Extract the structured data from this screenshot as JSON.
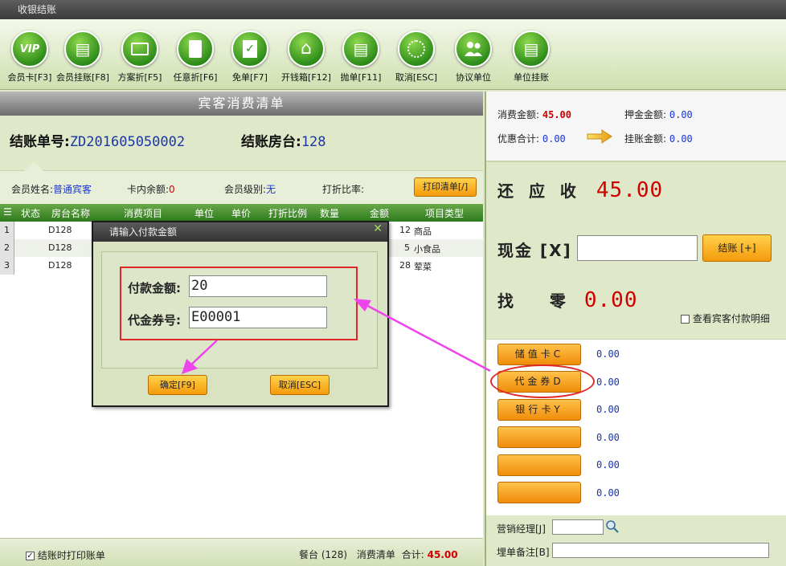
{
  "window": {
    "title": "收银结账"
  },
  "toolbar": [
    {
      "label": "会员卡[F3]",
      "icon": "vip-card-icon",
      "glyph": "VIP"
    },
    {
      "label": "会员挂账[F8]",
      "icon": "member-credit-icon",
      "glyph": "▤"
    },
    {
      "label": "方案折[F5]",
      "icon": "plan-discount-icon",
      "glyph": "▭"
    },
    {
      "label": "任意折[F6]",
      "icon": "any-discount-icon",
      "glyph": "▯"
    },
    {
      "label": "免单[F7]",
      "icon": "free-order-icon",
      "glyph": "✓"
    },
    {
      "label": "开钱箱[F12]",
      "icon": "cash-drawer-icon",
      "glyph": "⌂"
    },
    {
      "label": "抛单[F11]",
      "icon": "hold-order-icon",
      "glyph": "▤"
    },
    {
      "label": "取消[ESC]",
      "icon": "cancel-icon",
      "glyph": "◌"
    },
    {
      "label": "协议单位",
      "icon": "agreement-unit-icon",
      "glyph": "👥"
    },
    {
      "label": "单位挂账",
      "icon": "unit-credit-icon",
      "glyph": "▤"
    }
  ],
  "bill": {
    "header": "宾客消费清单",
    "no_label": "结账单号:",
    "no_value": "ZD201605050002",
    "room_label": "结账房台:",
    "room_value": "128"
  },
  "info": {
    "member_name_label": "会员姓名:",
    "member_name_value": "普通宾客",
    "card_balance_label": "卡内余额:",
    "card_balance_value": "0",
    "member_level_label": "会员级别:",
    "member_level_value": "无",
    "discount_label": "打折比率:",
    "print_button": "打印清单[/]"
  },
  "grid": {
    "columns": [
      "状态",
      "房台名称",
      "消费项目",
      "单位",
      "单价",
      "打折比例",
      "数量",
      "金额",
      "项目类型"
    ],
    "rows": [
      {
        "idx": "1",
        "room": "D128",
        "amount": "12",
        "type": "商品"
      },
      {
        "idx": "2",
        "room": "D128",
        "amount": "5",
        "type": "小食品"
      },
      {
        "idx": "3",
        "room": "D128",
        "amount": "28",
        "type": "荤菜"
      }
    ]
  },
  "footer_left": {
    "print_on_settle": "结账时打印账单",
    "summary_room": "餐台 (128)",
    "summary_list": "消费清单",
    "summary_total_label": "合计:",
    "summary_total_value": "45.00"
  },
  "summary": {
    "consume_label": "消费金额:",
    "consume_value": "45.00",
    "deposit_label": "押金金额:",
    "deposit_value": "0.00",
    "discount_label": "优惠合计:",
    "discount_value": "0.00",
    "credit_label": "挂账金额:",
    "credit_value": "0.00"
  },
  "payment": {
    "due_label": "还 应 收",
    "due_value": "45.00",
    "cash_label": "现金 [X]",
    "settle_button": "结账 [+]",
    "change_label": "找   零",
    "change_value": "0.00",
    "view_detail": "查看宾客付款明细",
    "methods": [
      {
        "label": "储值卡C",
        "value": "0.00"
      },
      {
        "label": "代金券D",
        "value": "0.00"
      },
      {
        "label": "银行卡Y",
        "value": "0.00"
      },
      {
        "label": "",
        "value": "0.00"
      },
      {
        "label": "",
        "value": "0.00"
      },
      {
        "label": "",
        "value": "0.00"
      }
    ],
    "manager_label": "营销经理[J]",
    "remark_label": "埋单备注[B]"
  },
  "dialog": {
    "title": "请输入付款金额",
    "amount_label": "付款金额:",
    "amount_value": "20",
    "voucher_label": "代金券号:",
    "voucher_value": "E00001",
    "ok_button": "确定[F9]",
    "cancel_button": "取消[ESC]"
  },
  "colors": {
    "accent_green": "#2f8e1a",
    "button_orange": "#f49a0c",
    "amount_red": "#d00000",
    "value_blue": "#1a36a8",
    "annotation_magenta": "#ee44ee",
    "highlight_red": "#e02828"
  }
}
